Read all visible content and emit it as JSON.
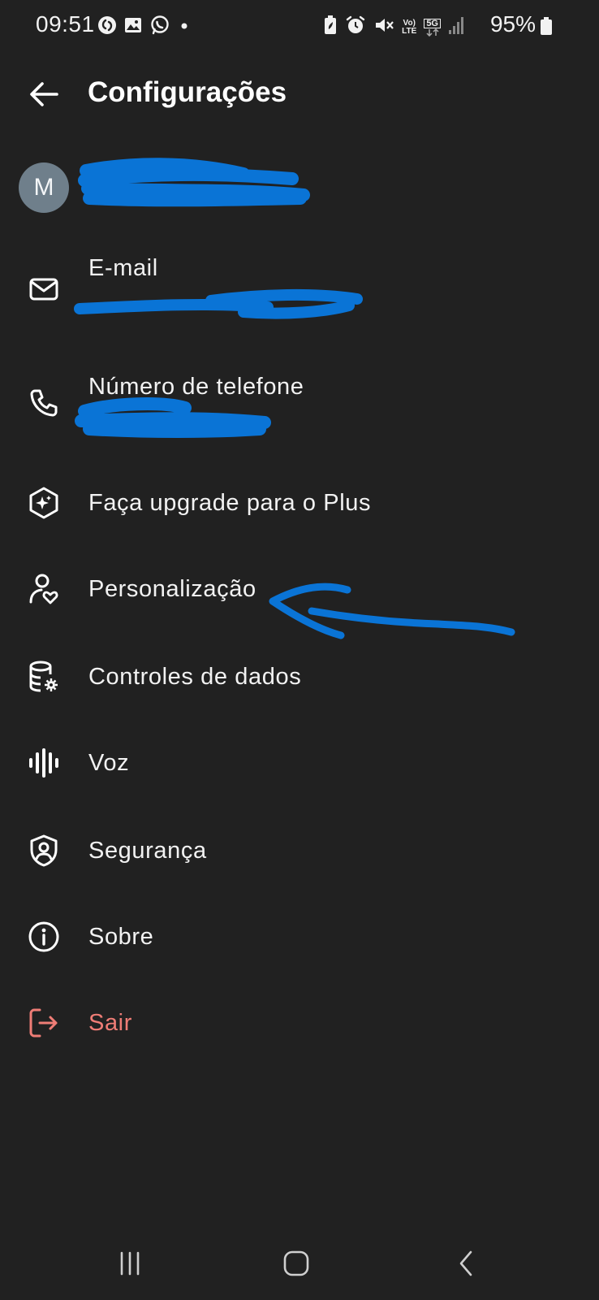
{
  "status_bar": {
    "time": "09:51",
    "battery": "95%",
    "network_top": "Vo)",
    "network_bottom": "LTE",
    "network_5g": "5G",
    "left_icons": [
      "shazam-icon",
      "gallery-icon",
      "whatsapp-icon",
      "dot-icon"
    ],
    "right_icons": [
      "battery-saver-icon",
      "alarm-icon",
      "mute-icon",
      "volte-icon",
      "5g-icon",
      "signal-icon"
    ]
  },
  "header": {
    "title": "Configurações"
  },
  "account": {
    "avatar_initial": "M",
    "name": ""
  },
  "items": [
    {
      "icon": "mail-icon",
      "label": "E-mail",
      "value": ""
    },
    {
      "icon": "phone-icon",
      "label": "Número de telefone",
      "value": ""
    },
    {
      "icon": "sparkle-hexagon-icon",
      "label": "Faça upgrade para o Plus"
    },
    {
      "icon": "person-heart-icon",
      "label": "Personalização"
    },
    {
      "icon": "database-gear-icon",
      "label": "Controles de dados"
    },
    {
      "icon": "voice-waveform-icon",
      "label": "Voz"
    },
    {
      "icon": "shield-user-icon",
      "label": "Segurança"
    },
    {
      "icon": "info-icon",
      "label": "Sobre"
    },
    {
      "icon": "logout-icon",
      "label": "Sair"
    }
  ],
  "colors": {
    "background": "#212121",
    "text": "#f2f2f2",
    "danger": "#ef7d76",
    "scribble": "#0a74d6",
    "avatar": "#6f7f8b"
  },
  "nav_bar": {
    "icons": [
      "recents-icon",
      "home-icon",
      "back-nav-icon"
    ]
  }
}
